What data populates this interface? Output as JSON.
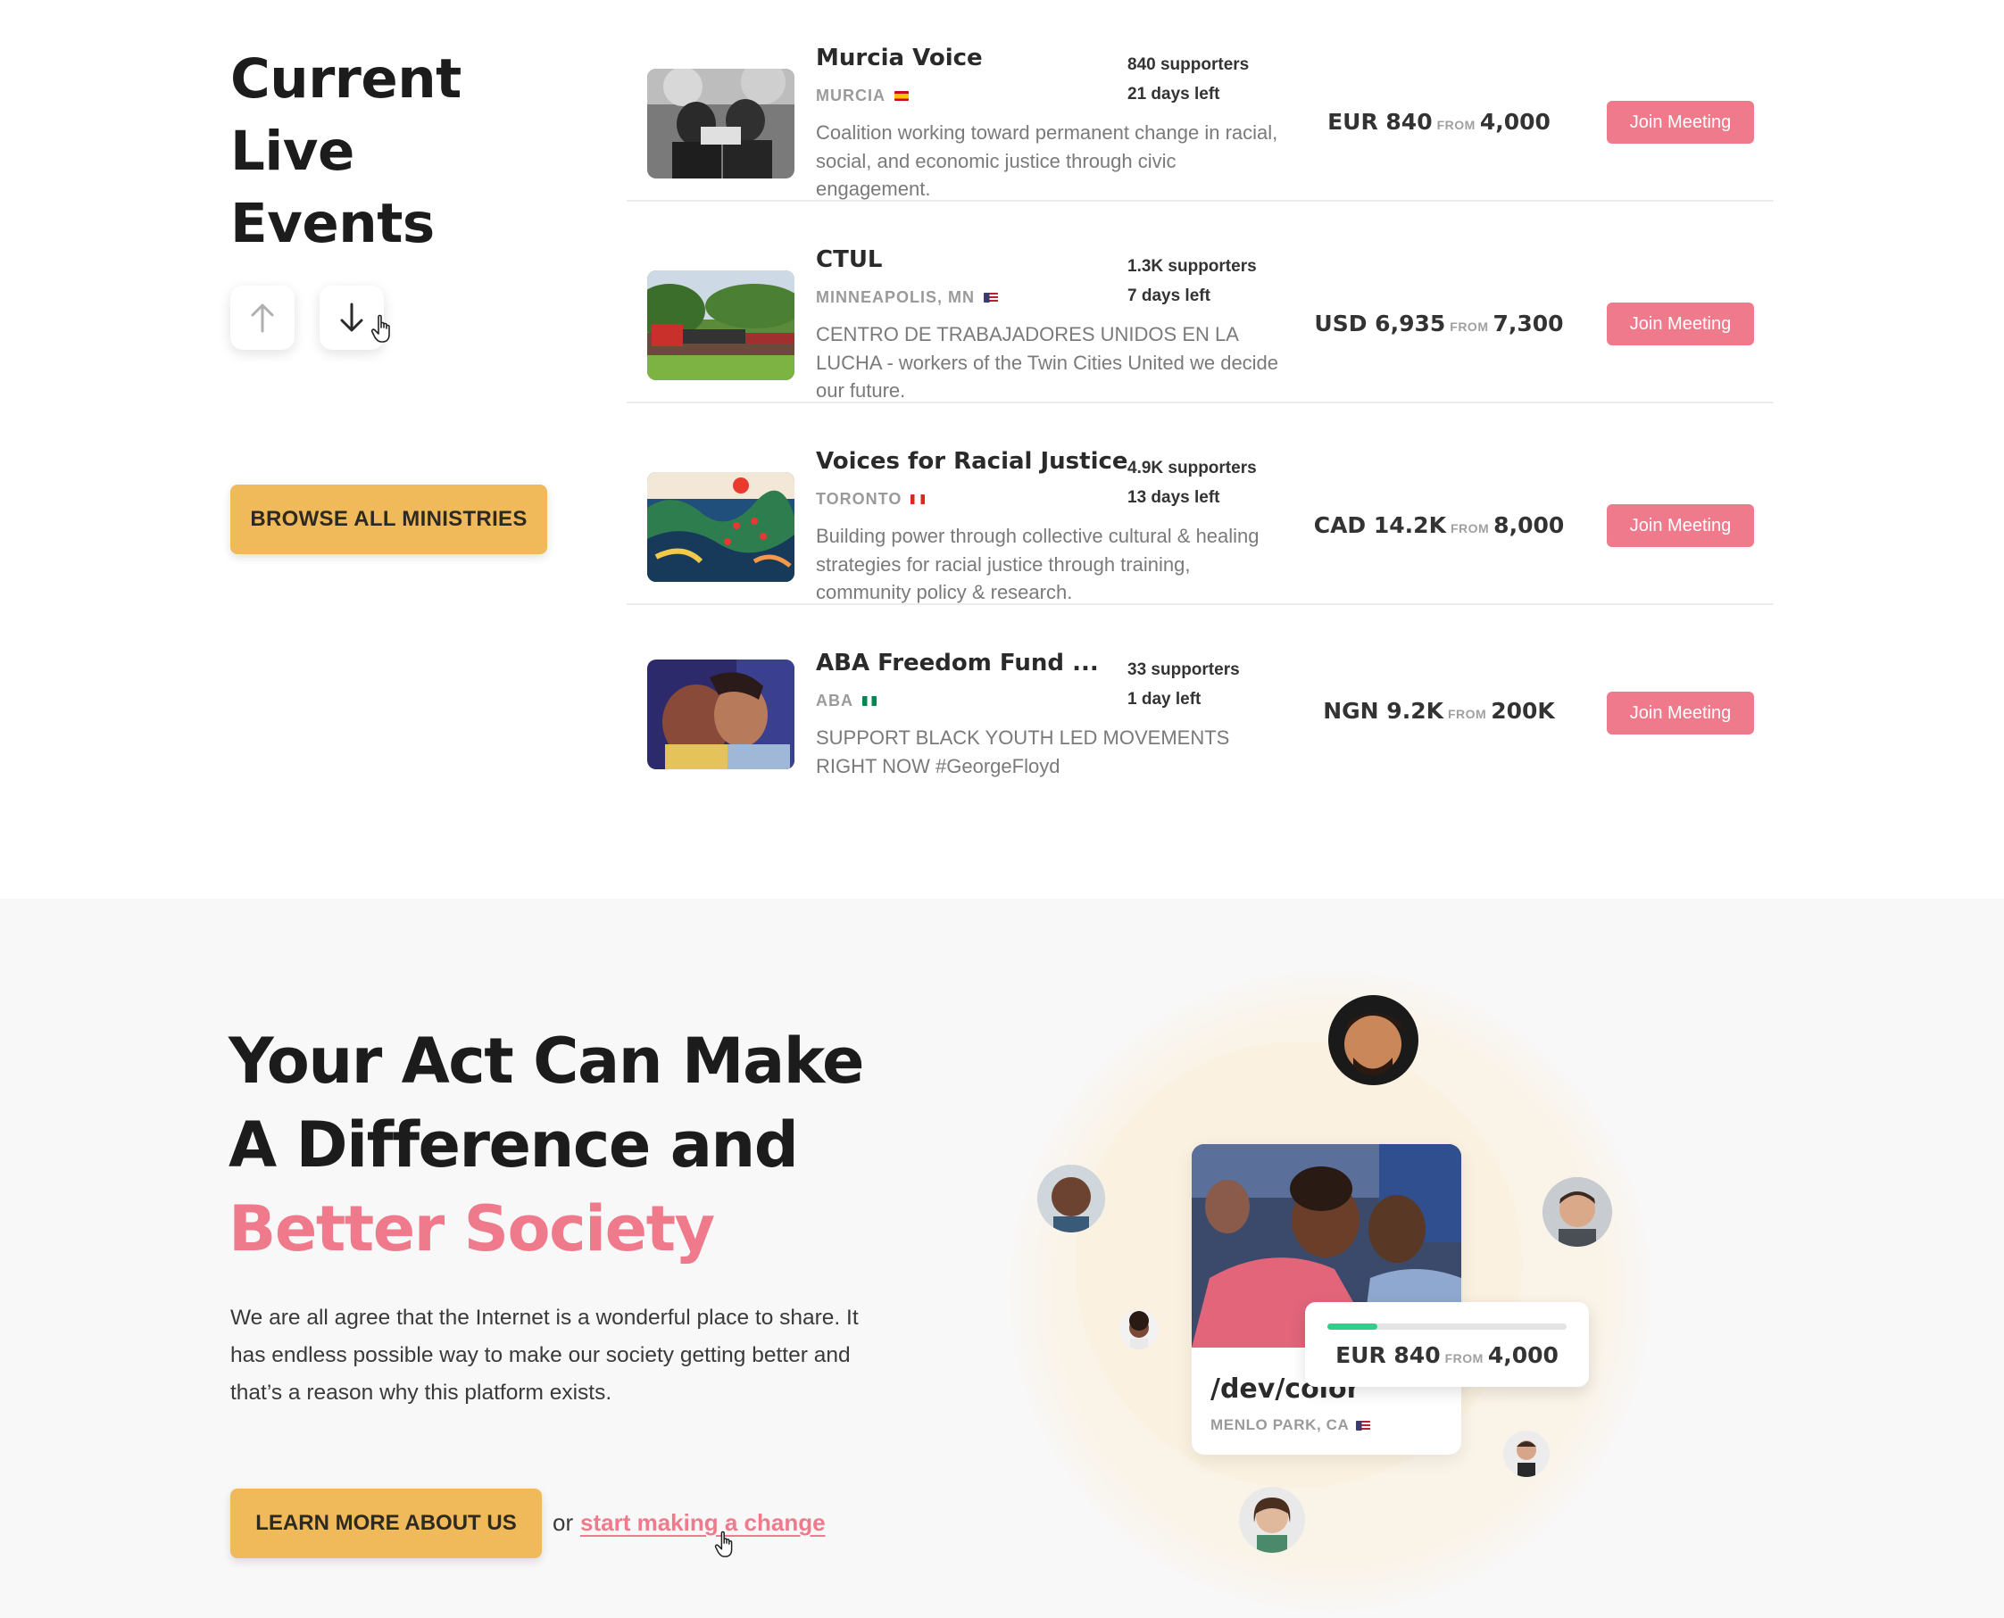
{
  "events_section": {
    "title_lines": [
      "Current",
      "Live",
      "Events"
    ],
    "browse_label": "BROWSE ALL MINISTRIES",
    "scroll_up_icon": "arrow-up-icon",
    "scroll_down_icon": "arrow-down-icon"
  },
  "events": [
    {
      "name": "Murcia Voice",
      "location": "MURCIA",
      "flag": "spain",
      "supporters": "840 supporters",
      "days_left": "21 days left",
      "description": "Coalition working toward permanent change in racial, social, and economic justice through civic engagement.",
      "raised": "EUR 840",
      "from_label": "FROM",
      "goal": "4,000",
      "button": "Join Meeting"
    },
    {
      "name": "CTUL",
      "location": "MINNEAPOLIS, MN",
      "flag": "usa",
      "supporters": "1.3K supporters",
      "days_left": "7 days left",
      "description": "CENTRO DE TRABAJADORES UNIDOS EN LA LUCHA - workers of the Twin Cities United we decide our future.",
      "raised": "USD 6,935",
      "from_label": "FROM",
      "goal": "7,300",
      "button": "Join Meeting"
    },
    {
      "name": "Voices for Racial Justice",
      "location": "TORONTO",
      "flag": "canada",
      "supporters": "4.9K supporters",
      "days_left": "13 days left",
      "description": "Building power through collective cultural & healing strategies for racial justice through training, community policy & research.",
      "raised": "CAD 14.2K",
      "from_label": "FROM",
      "goal": "8,000",
      "button": "Join Meeting"
    },
    {
      "name": "ABA Freedom Fund ...",
      "location": "ABA",
      "flag": "nigeria",
      "supporters": "33 supporters",
      "days_left": "1 day left",
      "description": "SUPPORT BLACK YOUTH LED MOVEMENTS RIGHT NOW #GeorgeFloyd",
      "raised": "NGN 9.2K",
      "from_label": "FROM",
      "goal": "200K",
      "button": "Join Meeting"
    }
  ],
  "hero": {
    "title_line1": "Your Act Can Make",
    "title_line2": "A Difference and",
    "title_accent": "Better Society",
    "text": "We are all agree that the Internet is a wonderful place to share. It has endless possible way to make our society getting better and that’s a reason why this platform exists.",
    "learn_label": "LEARN MORE ABOUT US",
    "or_text": "or",
    "link_text": "start making a change"
  },
  "featured_card": {
    "title": "/dev/color",
    "location": "MENLO PARK, CA",
    "flag": "usa",
    "raised": "EUR 840",
    "from_label": "FROM",
    "goal": "4,000",
    "progress_fraction": 0.21
  },
  "colors": {
    "accent_pink": "#ef7a8b",
    "button_yellow": "#f0b95a",
    "progress_green": "#2ecf8c"
  }
}
